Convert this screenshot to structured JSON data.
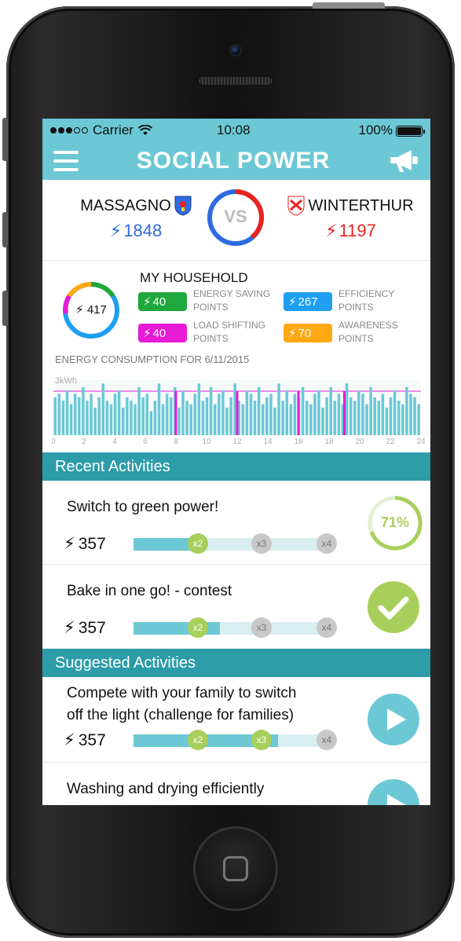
{
  "status_bar": {
    "carrier": "Carrier",
    "time": "10:08",
    "battery": "100%"
  },
  "app": {
    "title": "SOCIAL POWER"
  },
  "versus": {
    "left_team": {
      "name": "MASSAGNO",
      "points": "1848"
    },
    "vs_label": "VS",
    "right_team": {
      "name": "WINTERTHUR",
      "points": "1197"
    }
  },
  "household": {
    "title": "MY HOUSEHOLD",
    "total_points": "417",
    "badges": [
      {
        "value": "40",
        "label": "ENERGY SAVING POINTS",
        "color": "#1fa83b"
      },
      {
        "value": "267",
        "label": "EFFICIENCY POINTS",
        "color": "#1e9ff0"
      },
      {
        "value": "40",
        "label": "LOAD SHIFTING POINTS",
        "color": "#e81ad6"
      },
      {
        "value": "70",
        "label": "AWARENESS POINTS",
        "color": "#ffa812"
      }
    ],
    "consumption_label": "ENERGY CONSUMPTION FOR 6/11/2015"
  },
  "chart_data": {
    "type": "bar",
    "ylabel": "3kWh",
    "x_ticks": [
      "0",
      "2",
      "4",
      "6",
      "8",
      "10",
      "12",
      "14",
      "16",
      "18",
      "20",
      "22",
      "24"
    ],
    "values": [
      0.55,
      0.6,
      0.5,
      0.65,
      0.45,
      0.6,
      0.55,
      0.7,
      0.5,
      0.6,
      0.4,
      0.55,
      0.75,
      0.5,
      0.45,
      0.6,
      0.65,
      0.4,
      0.55,
      0.5,
      0.45,
      0.7,
      0.55,
      0.6,
      0.35,
      0.5,
      0.75,
      0.45,
      0.6,
      0.55,
      0.7,
      0.4,
      0.65,
      0.5,
      0.45,
      0.6,
      0.75,
      0.5,
      0.55,
      0.7,
      0.45,
      0.6,
      0.65,
      0.4,
      0.55,
      0.75,
      0.5,
      0.45,
      0.65,
      0.6,
      0.5,
      0.7,
      0.45,
      0.55,
      0.6,
      0.4,
      0.75,
      0.5,
      0.65,
      0.45,
      0.6,
      0.55,
      0.7,
      0.5,
      0.45,
      0.6,
      0.65,
      0.4,
      0.55,
      0.7,
      0.5,
      0.6,
      0.45,
      0.75,
      0.55,
      0.5,
      0.65,
      0.6,
      0.45,
      0.7,
      0.55,
      0.5,
      0.6,
      0.4,
      0.55,
      0.65,
      0.5,
      0.45,
      0.7,
      0.6,
      0.55,
      0.45
    ],
    "ylim": [
      0,
      0.8
    ],
    "highlight_hours": [
      8,
      12,
      16,
      19
    ],
    "bar_color": "#6bc8d4",
    "highlight_color": "#e81ad6"
  },
  "recent": {
    "heading": "Recent Activities",
    "items": [
      {
        "title": "Switch to green power!",
        "points": "357",
        "multipliers": [
          "x2",
          "x3",
          "x4"
        ],
        "progress": 0.33,
        "status": "71%"
      },
      {
        "title": "Bake in one go! - contest",
        "points": "357",
        "multipliers": [
          "x2",
          "x3",
          "x4"
        ],
        "progress": 0.43,
        "status": "done"
      }
    ]
  },
  "suggested": {
    "heading": "Suggested Activities",
    "items": [
      {
        "title_line1": "Compete with your family to switch",
        "title_line2": "off the light (challenge for families)",
        "points": "357",
        "multipliers": [
          "x2",
          "x3",
          "x4"
        ],
        "progress": 0.72
      },
      {
        "title_line1": "Washing and drying efficiently"
      }
    ]
  }
}
